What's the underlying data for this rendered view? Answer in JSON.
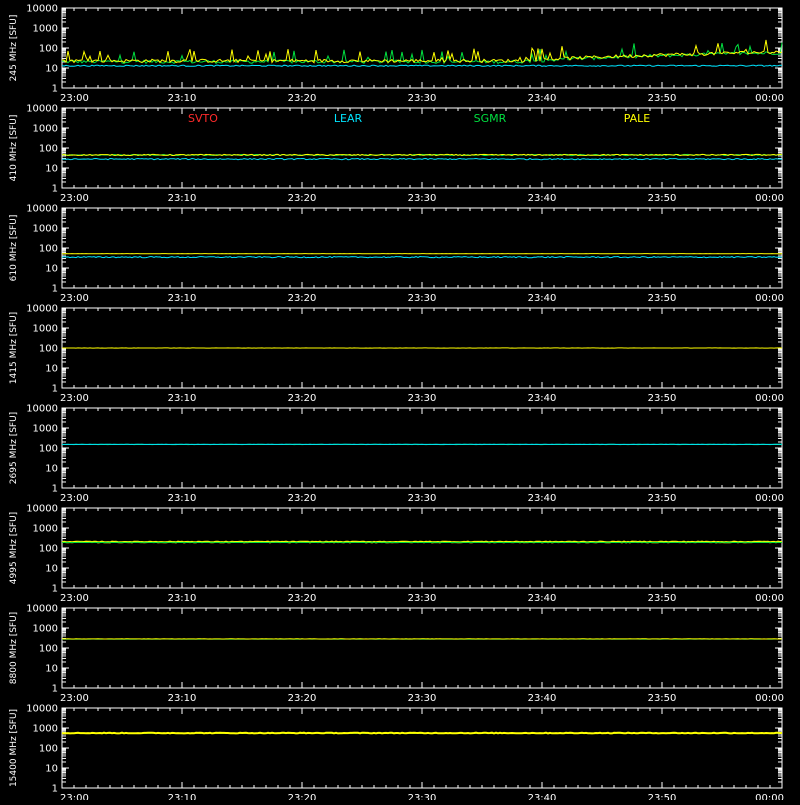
{
  "chart_data": {
    "type": "line",
    "x_axis": {
      "tick_labels": [
        "23:00",
        "23:10",
        "23:20",
        "23:30",
        "23:40",
        "23:50",
        "00:00"
      ],
      "range_minutes": [
        0,
        60
      ]
    },
    "y_axis": {
      "scale": "log",
      "range": [
        1,
        10000
      ],
      "tick_labels": [
        "1",
        "10",
        "100",
        "1000",
        "10000"
      ]
    },
    "legend": {
      "placement": "inside-panel-2-top",
      "entries": [
        {
          "name": "SVTO",
          "color": "#ff2a2a"
        },
        {
          "name": "LEAR",
          "color": "#00e5ff"
        },
        {
          "name": "SGMR",
          "color": "#00e040"
        },
        {
          "name": "PALE",
          "color": "#ffff00"
        }
      ]
    },
    "panels": [
      {
        "ylabel": "245 MHz [SFU]",
        "series": [
          {
            "name": "SGMR",
            "level": 20,
            "noise": "bursty",
            "active": true
          },
          {
            "name": "PALE",
            "level": 22,
            "noise": "bursty",
            "active": true
          },
          {
            "name": "LEAR",
            "level": 13,
            "noise": "low",
            "active": true
          }
        ]
      },
      {
        "ylabel": "410 MHz [SFU]",
        "series": [
          {
            "name": "SGMR",
            "level": 45,
            "noise": "low",
            "active": true
          },
          {
            "name": "PALE",
            "level": 45,
            "noise": "low",
            "active": true
          },
          {
            "name": "LEAR",
            "level": 28,
            "noise": "low",
            "active": true
          }
        ]
      },
      {
        "ylabel": "610 MHz [SFU]",
        "series": [
          {
            "name": "PALE",
            "level": 52,
            "noise": "flat",
            "active": true
          },
          {
            "name": "LEAR",
            "level": 35,
            "noise": "low",
            "active": true
          }
        ]
      },
      {
        "ylabel": "1415 MHz [SFU]",
        "series": [
          {
            "name": "PALE",
            "level": 100,
            "noise": "flat",
            "active": true
          }
        ]
      },
      {
        "ylabel": "2695 MHz [SFU]",
        "series": [
          {
            "name": "SGMR",
            "level": 150,
            "noise": "flat",
            "active": true
          },
          {
            "name": "LEAR",
            "level": 152,
            "noise": "flat",
            "active": true
          }
        ]
      },
      {
        "ylabel": "4995 MHz [SFU]",
        "series": [
          {
            "name": "PALE",
            "level": 200,
            "noise": "dense",
            "active": true
          },
          {
            "name": "SGMR",
            "level": 190,
            "noise": "flat",
            "active": true
          }
        ]
      },
      {
        "ylabel": "8800 MHz [SFU]",
        "series": [
          {
            "name": "SGMR",
            "level": 280,
            "noise": "flat",
            "active": true
          },
          {
            "name": "PALE",
            "level": 285,
            "noise": "flat",
            "active": true
          }
        ]
      },
      {
        "ylabel": "15400 MHz [SFU]",
        "series": [
          {
            "name": "SGMR",
            "level": 550,
            "noise": "flat",
            "active": true
          },
          {
            "name": "PALE",
            "level": 560,
            "noise": "dense",
            "active": true
          }
        ]
      }
    ]
  }
}
